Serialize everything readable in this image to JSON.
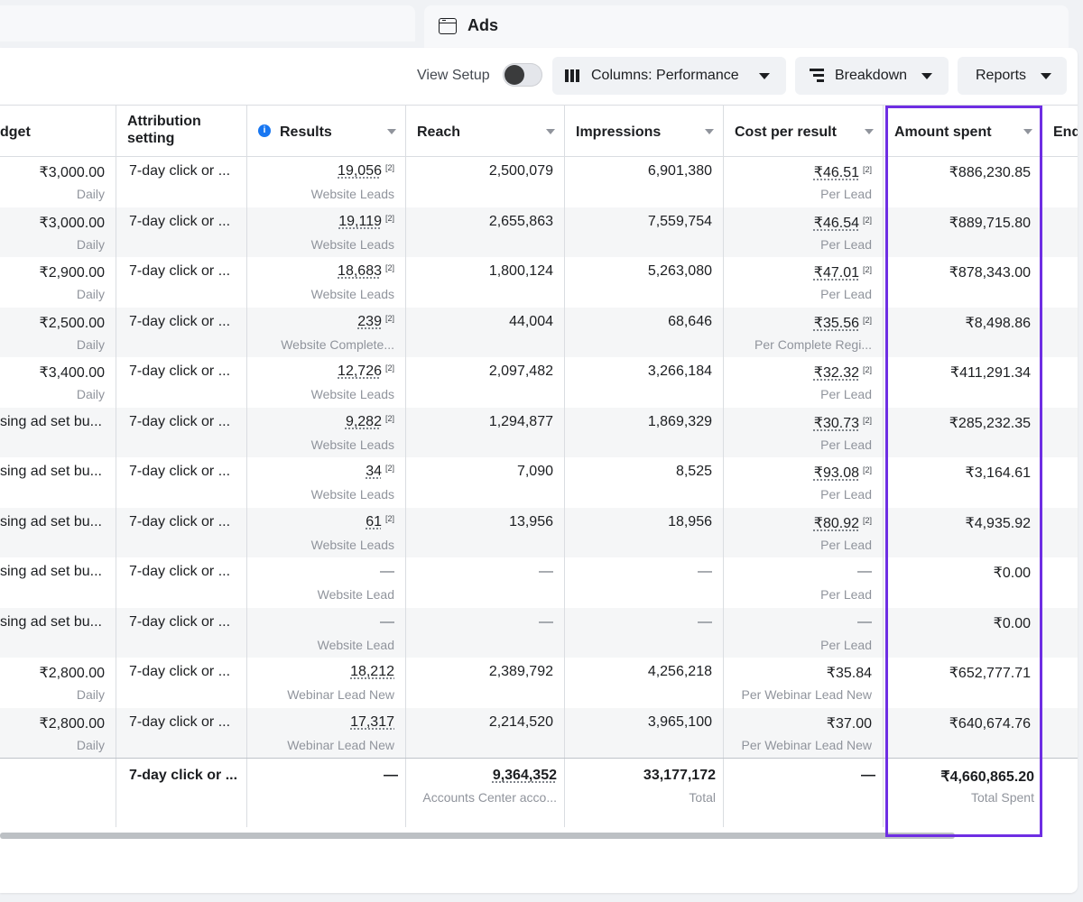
{
  "header": {
    "ads_title": "Ads"
  },
  "toolbar": {
    "view_setup": "View Setup",
    "columns": "Columns: Performance",
    "breakdown": "Breakdown",
    "reports": "Reports"
  },
  "columns": {
    "budget": "dget",
    "attribution_1": "Attribution",
    "attribution_2": "setting",
    "results": "Results",
    "reach": "Reach",
    "impressions": "Impressions",
    "cost": "Cost per result",
    "spent": "Amount spent",
    "ends": "End"
  },
  "rows": [
    {
      "budget": "₹3,000.00",
      "budget_sub": "Daily",
      "attr": "7-day click or ...",
      "results": "19,056",
      "results_sub": "Website Leads",
      "reach": "2,500,079",
      "impressions": "6,901,380",
      "cost": "₹46.51",
      "cost_sub": "Per Lead",
      "spent": "₹886,230.85",
      "marker": "[2]"
    },
    {
      "budget": "₹3,000.00",
      "budget_sub": "Daily",
      "attr": "7-day click or ...",
      "results": "19,119",
      "results_sub": "Website Leads",
      "reach": "2,655,863",
      "impressions": "7,559,754",
      "cost": "₹46.54",
      "cost_sub": "Per Lead",
      "spent": "₹889,715.80",
      "marker": "[2]"
    },
    {
      "budget": "₹2,900.00",
      "budget_sub": "Daily",
      "attr": "7-day click or ...",
      "results": "18,683",
      "results_sub": "Website Leads",
      "reach": "1,800,124",
      "impressions": "5,263,080",
      "cost": "₹47.01",
      "cost_sub": "Per Lead",
      "spent": "₹878,343.00",
      "marker": "[2]"
    },
    {
      "budget": "₹2,500.00",
      "budget_sub": "Daily",
      "attr": "7-day click or ...",
      "results": "239",
      "results_sub": "Website Complete...",
      "reach": "44,004",
      "impressions": "68,646",
      "cost": "₹35.56",
      "cost_sub": "Per Complete Regi...",
      "spent": "₹8,498.86",
      "marker": "[2]"
    },
    {
      "budget": "₹3,400.00",
      "budget_sub": "Daily",
      "attr": "7-day click or ...",
      "results": "12,726",
      "results_sub": "Website Leads",
      "reach": "2,097,482",
      "impressions": "3,266,184",
      "cost": "₹32.32",
      "cost_sub": "Per Lead",
      "spent": "₹411,291.34",
      "marker": "[2]"
    },
    {
      "budget": "sing ad set bu...",
      "budget_sub": "",
      "attr": "7-day click or ...",
      "results": "9,282",
      "results_sub": "Website Leads",
      "reach": "1,294,877",
      "impressions": "1,869,329",
      "cost": "₹30.73",
      "cost_sub": "Per Lead",
      "spent": "₹285,232.35",
      "marker": "[2]"
    },
    {
      "budget": "sing ad set bu...",
      "budget_sub": "",
      "attr": "7-day click or ...",
      "results": "34",
      "results_sub": "Website Leads",
      "reach": "7,090",
      "impressions": "8,525",
      "cost": "₹93.08",
      "cost_sub": "Per Lead",
      "spent": "₹3,164.61",
      "marker": "[2]"
    },
    {
      "budget": "sing ad set bu...",
      "budget_sub": "",
      "attr": "7-day click or ...",
      "results": "61",
      "results_sub": "Website Leads",
      "reach": "13,956",
      "impressions": "18,956",
      "cost": "₹80.92",
      "cost_sub": "Per Lead",
      "spent": "₹4,935.92",
      "marker": "[2]"
    },
    {
      "budget": "sing ad set bu...",
      "budget_sub": "",
      "attr": "7-day click or ...",
      "results": "—",
      "results_sub": "Website Lead",
      "reach": "—",
      "impressions": "—",
      "cost": "—",
      "cost_sub": "Per Lead",
      "spent": "₹0.00",
      "marker": ""
    },
    {
      "budget": "sing ad set bu...",
      "budget_sub": "",
      "attr": "7-day click or ...",
      "results": "—",
      "results_sub": "Website Lead",
      "reach": "—",
      "impressions": "—",
      "cost": "—",
      "cost_sub": "Per Lead",
      "spent": "₹0.00",
      "marker": ""
    },
    {
      "budget": "₹2,800.00",
      "budget_sub": "Daily",
      "attr": "7-day click or ...",
      "results": "18,212",
      "results_sub": "Webinar Lead New",
      "reach": "2,389,792",
      "impressions": "4,256,218",
      "cost": "₹35.84",
      "cost_sub": "Per Webinar Lead New",
      "spent": "₹652,777.71",
      "marker": ""
    },
    {
      "budget": "₹2,800.00",
      "budget_sub": "Daily",
      "attr": "7-day click or ...",
      "results": "17,317",
      "results_sub": "Webinar Lead New",
      "reach": "2,214,520",
      "impressions": "3,965,100",
      "cost": "₹37.00",
      "cost_sub": "Per Webinar Lead New",
      "spent": "₹640,674.76",
      "marker": ""
    }
  ],
  "totals": {
    "attr": "7-day click or ...",
    "results": "—",
    "reach": "9,364,352",
    "reach_sub": "Accounts Center acco...",
    "impressions": "33,177,172",
    "impressions_sub": "Total",
    "cost": "—",
    "spent": "₹4,660,865.20",
    "spent_sub": "Total Spent"
  },
  "colors": {
    "highlight": "#6e2ee3",
    "accent": "#1877f2"
  }
}
